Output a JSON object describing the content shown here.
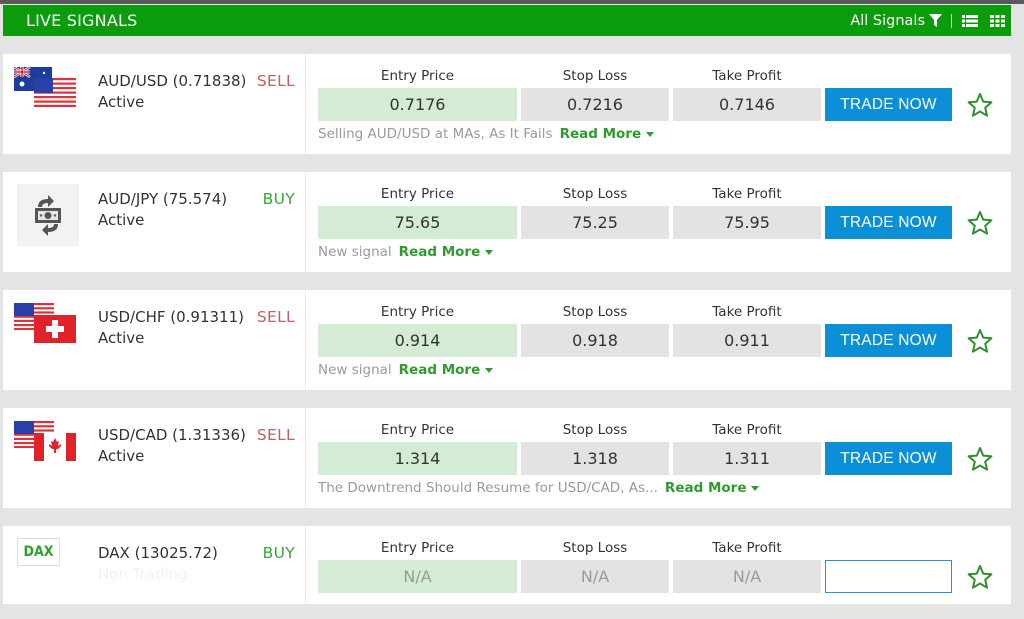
{
  "header": {
    "title": "LIVE SIGNALS",
    "filter_label": "All Signals",
    "icons": [
      "filter-icon",
      "list-view-icon",
      "grid-view-icon"
    ],
    "color": "#0a9c0a"
  },
  "columns": {
    "entry": "Entry Price",
    "stop": "Stop Loss",
    "take": "Take Profit"
  },
  "colors": {
    "sell": "#c0625f",
    "buy": "#3aa53a",
    "trade_button": "#0b8fd6",
    "entry_cell": "#d4ebd4",
    "read_more": "#2f9a2f"
  },
  "signals": [
    {
      "icon": "aud-usd-flags-icon",
      "name": "AUD/USD (0.71838)",
      "status": "Active",
      "side": "SELL",
      "entry": "0.7176",
      "stop": "0.7216",
      "take": "0.7146",
      "trade_label": "TRADE NOW",
      "description": "Selling AUD/USD at MAs, As It Fails",
      "read_more": "Read More"
    },
    {
      "icon": "currency-exchange-icon",
      "name": "AUD/JPY (75.574)",
      "status": "Active",
      "side": "BUY",
      "entry": "75.65",
      "stop": "75.25",
      "take": "75.95",
      "trade_label": "TRADE NOW",
      "description": "New signal",
      "read_more": "Read More"
    },
    {
      "icon": "usd-chf-flags-icon",
      "name": "USD/CHF (0.91311)",
      "status": "Active",
      "side": "SELL",
      "entry": "0.914",
      "stop": "0.918",
      "take": "0.911",
      "trade_label": "TRADE NOW",
      "description": "New signal",
      "read_more": "Read More"
    },
    {
      "icon": "usd-cad-flags-icon",
      "name": "USD/CAD (1.31336)",
      "status": "Active",
      "side": "SELL",
      "entry": "1.314",
      "stop": "1.318",
      "take": "1.311",
      "trade_label": "TRADE NOW",
      "description": "The Downtrend Should Resume for USD/CAD, As...",
      "read_more": "Read More"
    },
    {
      "icon": "dax-logo-icon",
      "icon_text": "DAX",
      "name": "DAX (13025.72)",
      "status": "Non Trading",
      "side": "BUY",
      "entry": "N/A",
      "stop": "N/A",
      "take": "N/A",
      "trade_label": ""
    }
  ]
}
